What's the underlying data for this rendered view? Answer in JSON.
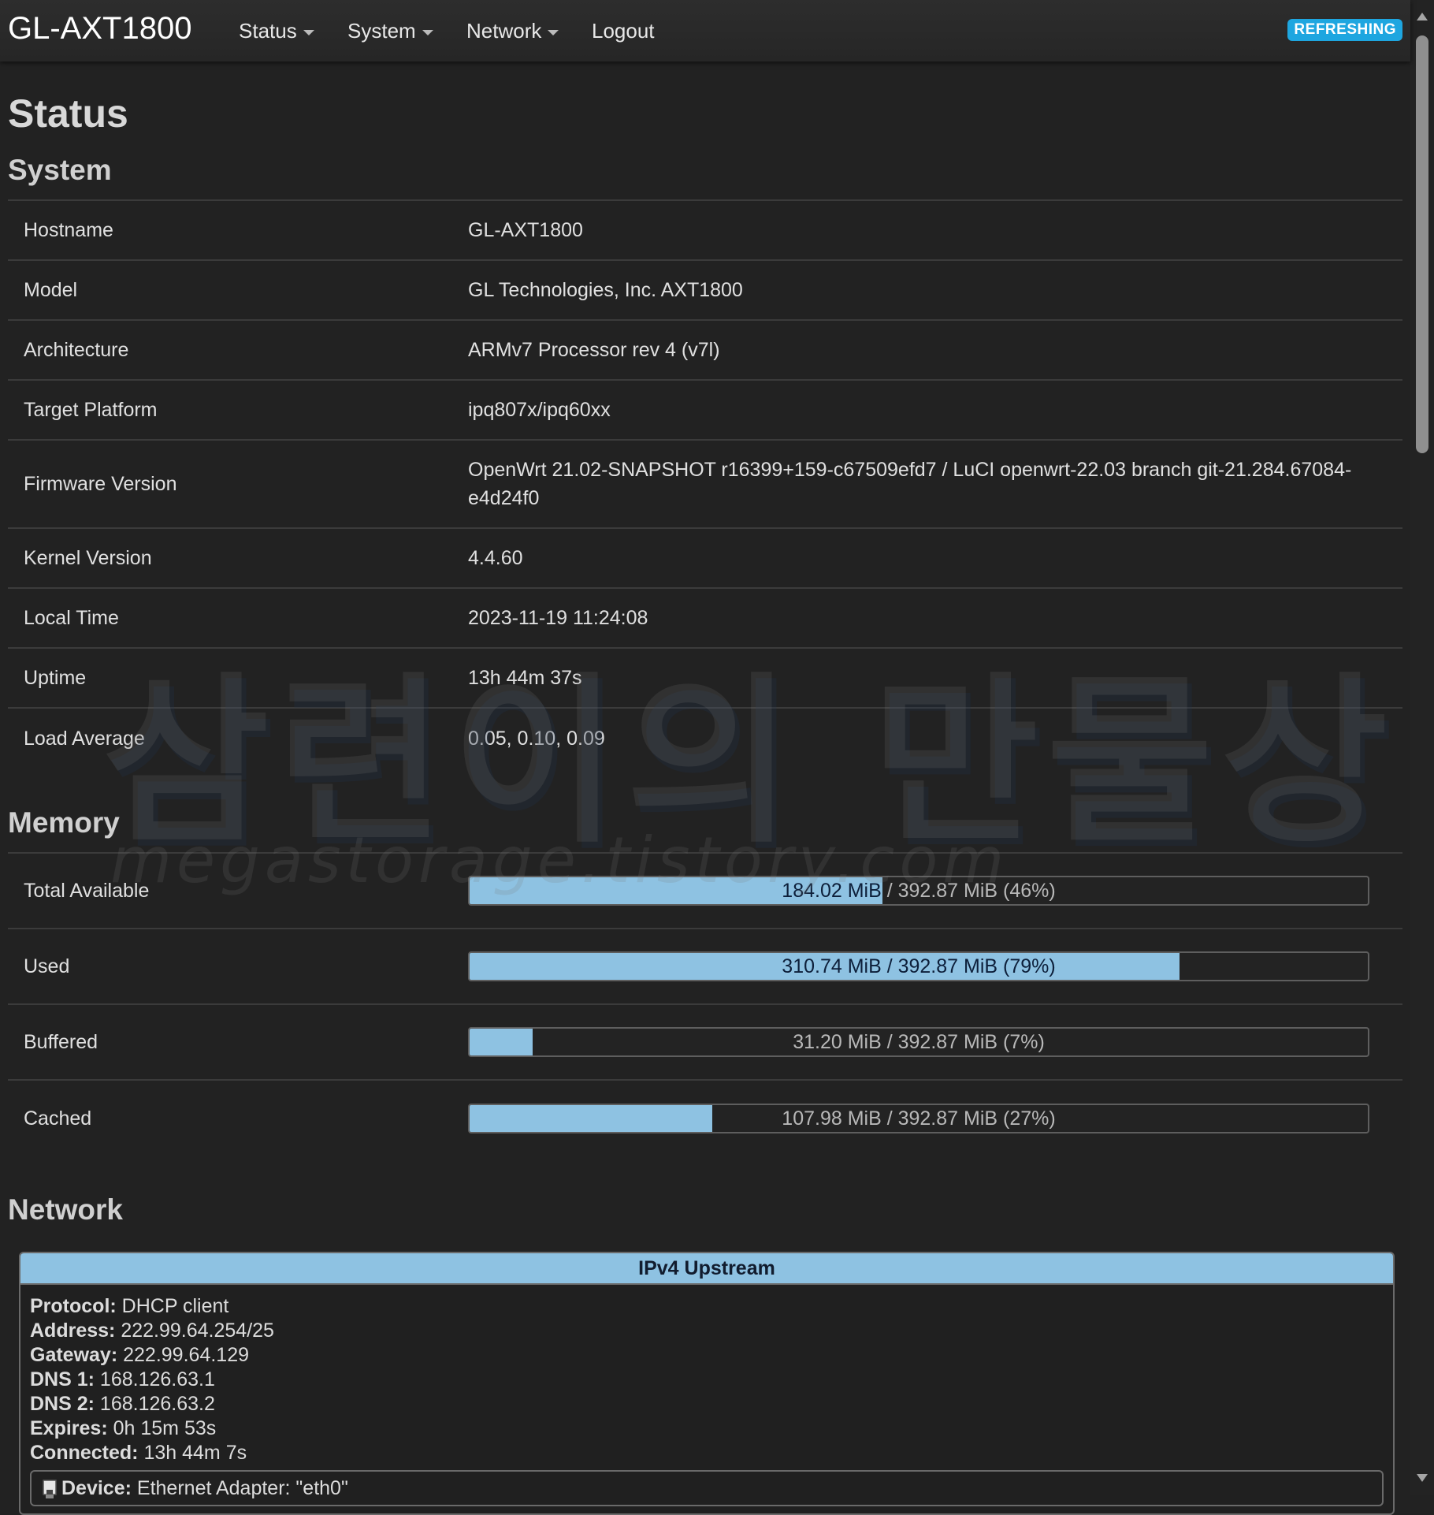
{
  "navbar": {
    "brand": "GL-AXT1800",
    "menu": [
      {
        "label": "Status",
        "dropdown": true
      },
      {
        "label": "System",
        "dropdown": true
      },
      {
        "label": "Network",
        "dropdown": true
      },
      {
        "label": "Logout",
        "dropdown": false
      }
    ],
    "refresh_badge": "REFRESHING"
  },
  "page_title": "Status",
  "system": {
    "title": "System",
    "rows": [
      {
        "label": "Hostname",
        "value": "GL-AXT1800"
      },
      {
        "label": "Model",
        "value": "GL Technologies, Inc. AXT1800"
      },
      {
        "label": "Architecture",
        "value": "ARMv7 Processor rev 4 (v7l)"
      },
      {
        "label": "Target Platform",
        "value": "ipq807x/ipq60xx"
      },
      {
        "label": "Firmware Version",
        "value": "OpenWrt 21.02-SNAPSHOT r16399+159-c67509efd7 / LuCI openwrt-22.03 branch git-21.284.67084-e4d24f0"
      },
      {
        "label": "Kernel Version",
        "value": "4.4.60"
      },
      {
        "label": "Local Time",
        "value": "2023-11-19 11:24:08"
      },
      {
        "label": "Uptime",
        "value": "13h 44m 37s"
      },
      {
        "label": "Load Average",
        "value": "0.05, 0.10, 0.09"
      }
    ]
  },
  "memory": {
    "title": "Memory",
    "rows": [
      {
        "label": "Total Available",
        "fill_percent": 46,
        "value_text": "184.02 MiB",
        "rest_text": " / 392.87 MiB (46%)"
      },
      {
        "label": "Used",
        "fill_percent": 79,
        "value_text": "310.74 MiB / 392.87 MiB (79%)",
        "rest_text": ""
      },
      {
        "label": "Buffered",
        "fill_percent": 7,
        "value_text": "31.20 MiB / 392.87 MiB (7%)",
        "rest_text": ""
      },
      {
        "label": "Cached",
        "fill_percent": 27,
        "value_text": "107.98 MiB / 392.87 MiB (27%)",
        "rest_text": ""
      }
    ]
  },
  "network": {
    "title": "Network",
    "ipv4_upstream": {
      "header": "IPv4 Upstream",
      "fields": [
        {
          "key": "Protocol:",
          "value": "DHCP client"
        },
        {
          "key": "Address:",
          "value": "222.99.64.254/25"
        },
        {
          "key": "Gateway:",
          "value": "222.99.64.129"
        },
        {
          "key": "DNS 1:",
          "value": "168.126.63.1"
        },
        {
          "key": "DNS 2:",
          "value": "168.126.63.2"
        },
        {
          "key": "Expires:",
          "value": "0h 15m 53s"
        },
        {
          "key": "Connected:",
          "value": "13h 44m 7s"
        }
      ],
      "device_key": "Device:",
      "device_value": "Ethernet Adapter: \"eth0\""
    }
  },
  "watermark": {
    "main": "삼련이의 만물상",
    "sub": "megastorage.tistory.com"
  },
  "colors": {
    "background": "#222222",
    "bar_fill": "#8ec2e2",
    "badge": "#1ea6e0"
  }
}
